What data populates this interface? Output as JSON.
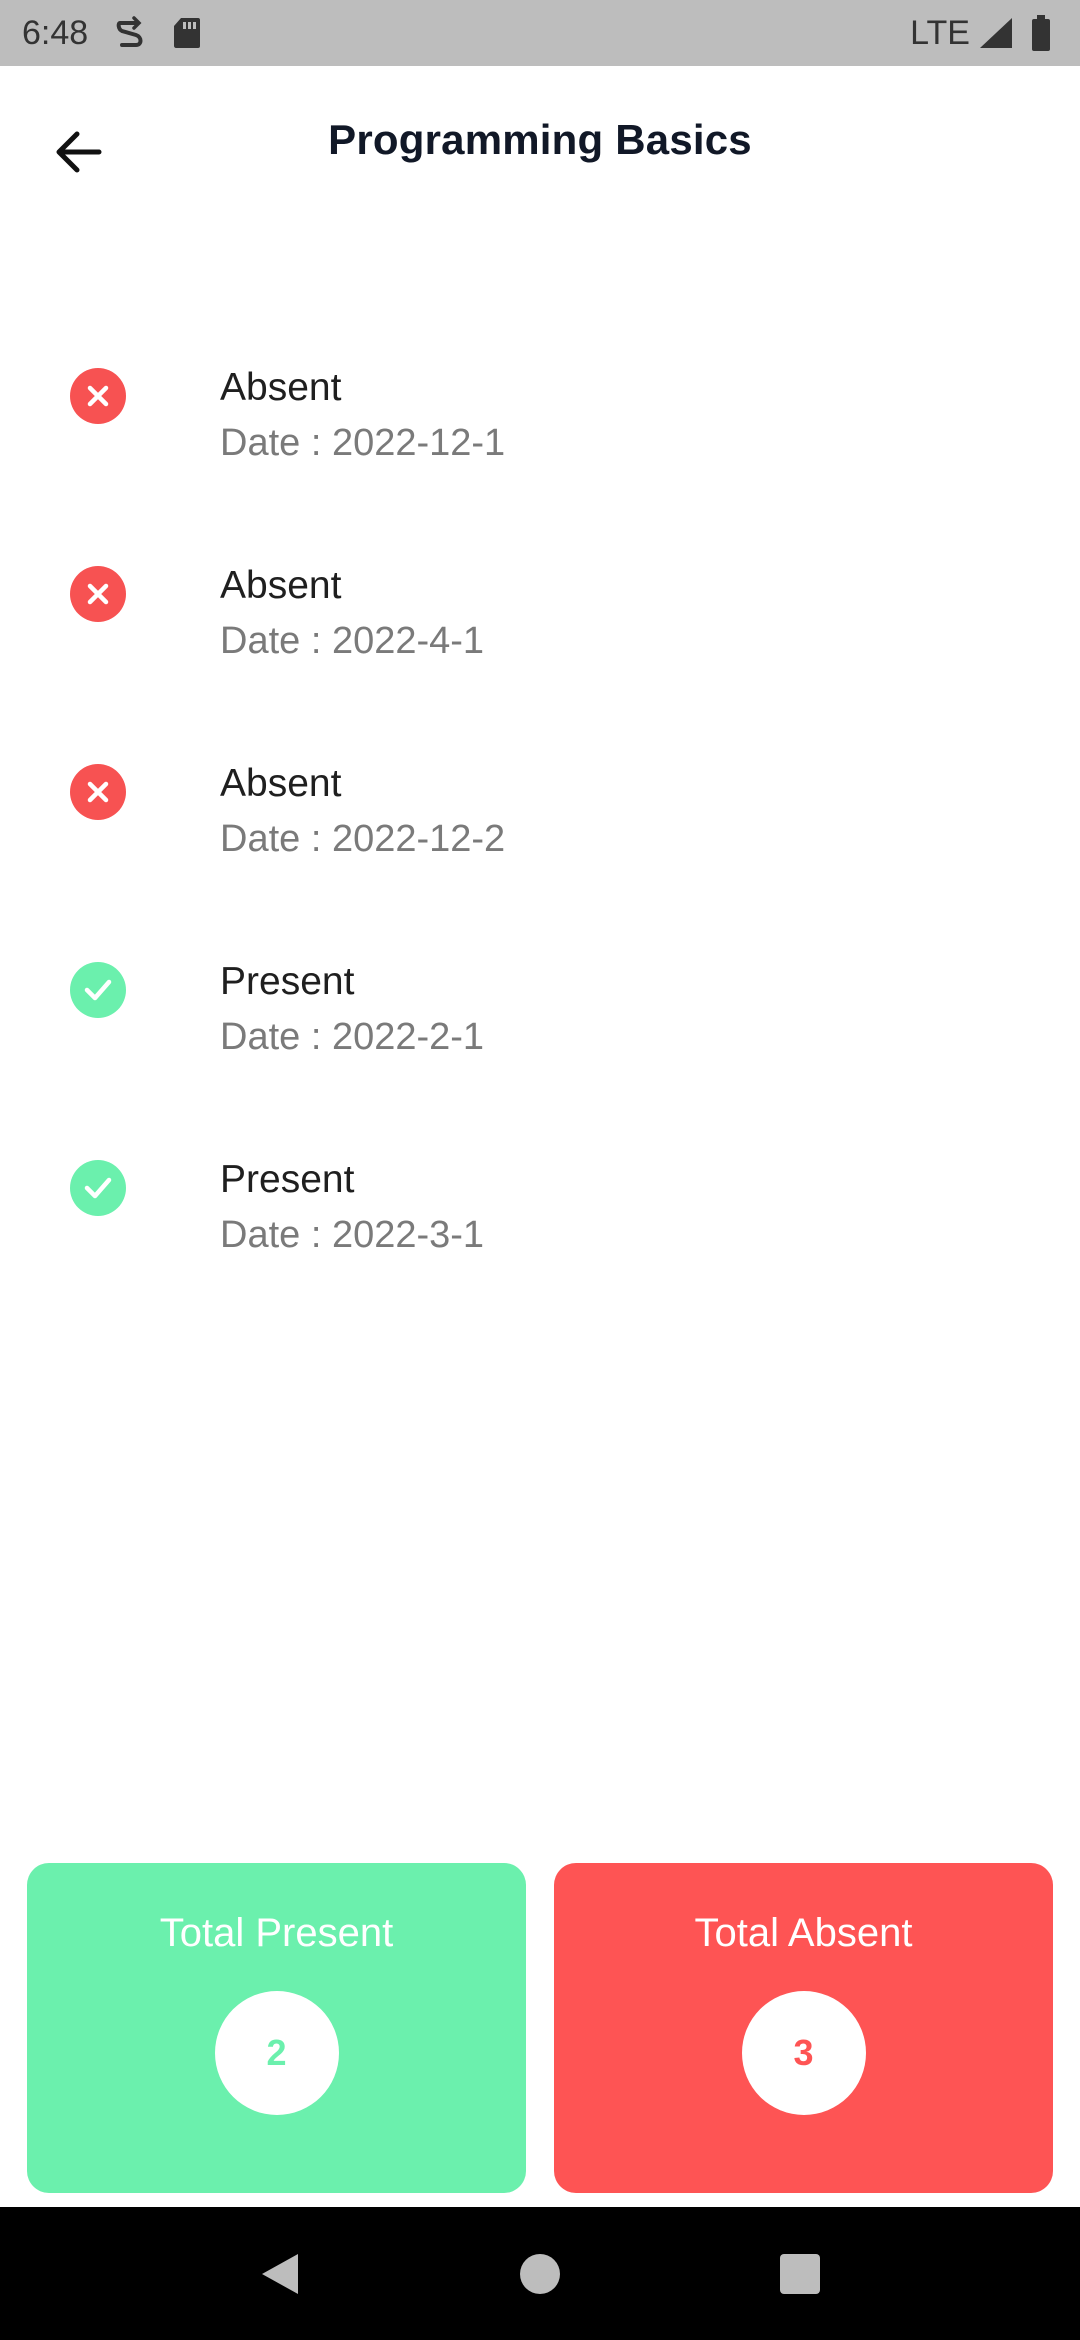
{
  "status_bar": {
    "time": "6:48",
    "network": "LTE",
    "icons_left": [
      "sync-icon",
      "sd-card-icon"
    ],
    "icons_right": [
      "signal-icon",
      "battery-icon"
    ]
  },
  "app_bar": {
    "title": "Programming Basics",
    "back_icon": "arrow-left-icon"
  },
  "records": [
    {
      "status": "Absent",
      "date": "Date : 2022-12-1",
      "type": "absent"
    },
    {
      "status": "Absent",
      "date": "Date : 2022-4-1",
      "type": "absent"
    },
    {
      "status": "Absent",
      "date": "Date : 2022-12-2",
      "type": "absent"
    },
    {
      "status": "Present",
      "date": "Date : 2022-2-1",
      "type": "present"
    },
    {
      "status": "Present",
      "date": "Date : 2022-3-1",
      "type": "present"
    }
  ],
  "totals": {
    "present": {
      "label": "Total Present",
      "count": "2"
    },
    "absent": {
      "label": "Total Absent",
      "count": "3"
    }
  },
  "colors": {
    "present": "#6bf0ad",
    "absent": "#fe5454",
    "status_bar": "#bdbdbd",
    "nav_bar": "#000000"
  },
  "nav_bar": {
    "buttons": [
      "back-nav-icon",
      "home-nav-icon",
      "recents-nav-icon"
    ]
  }
}
